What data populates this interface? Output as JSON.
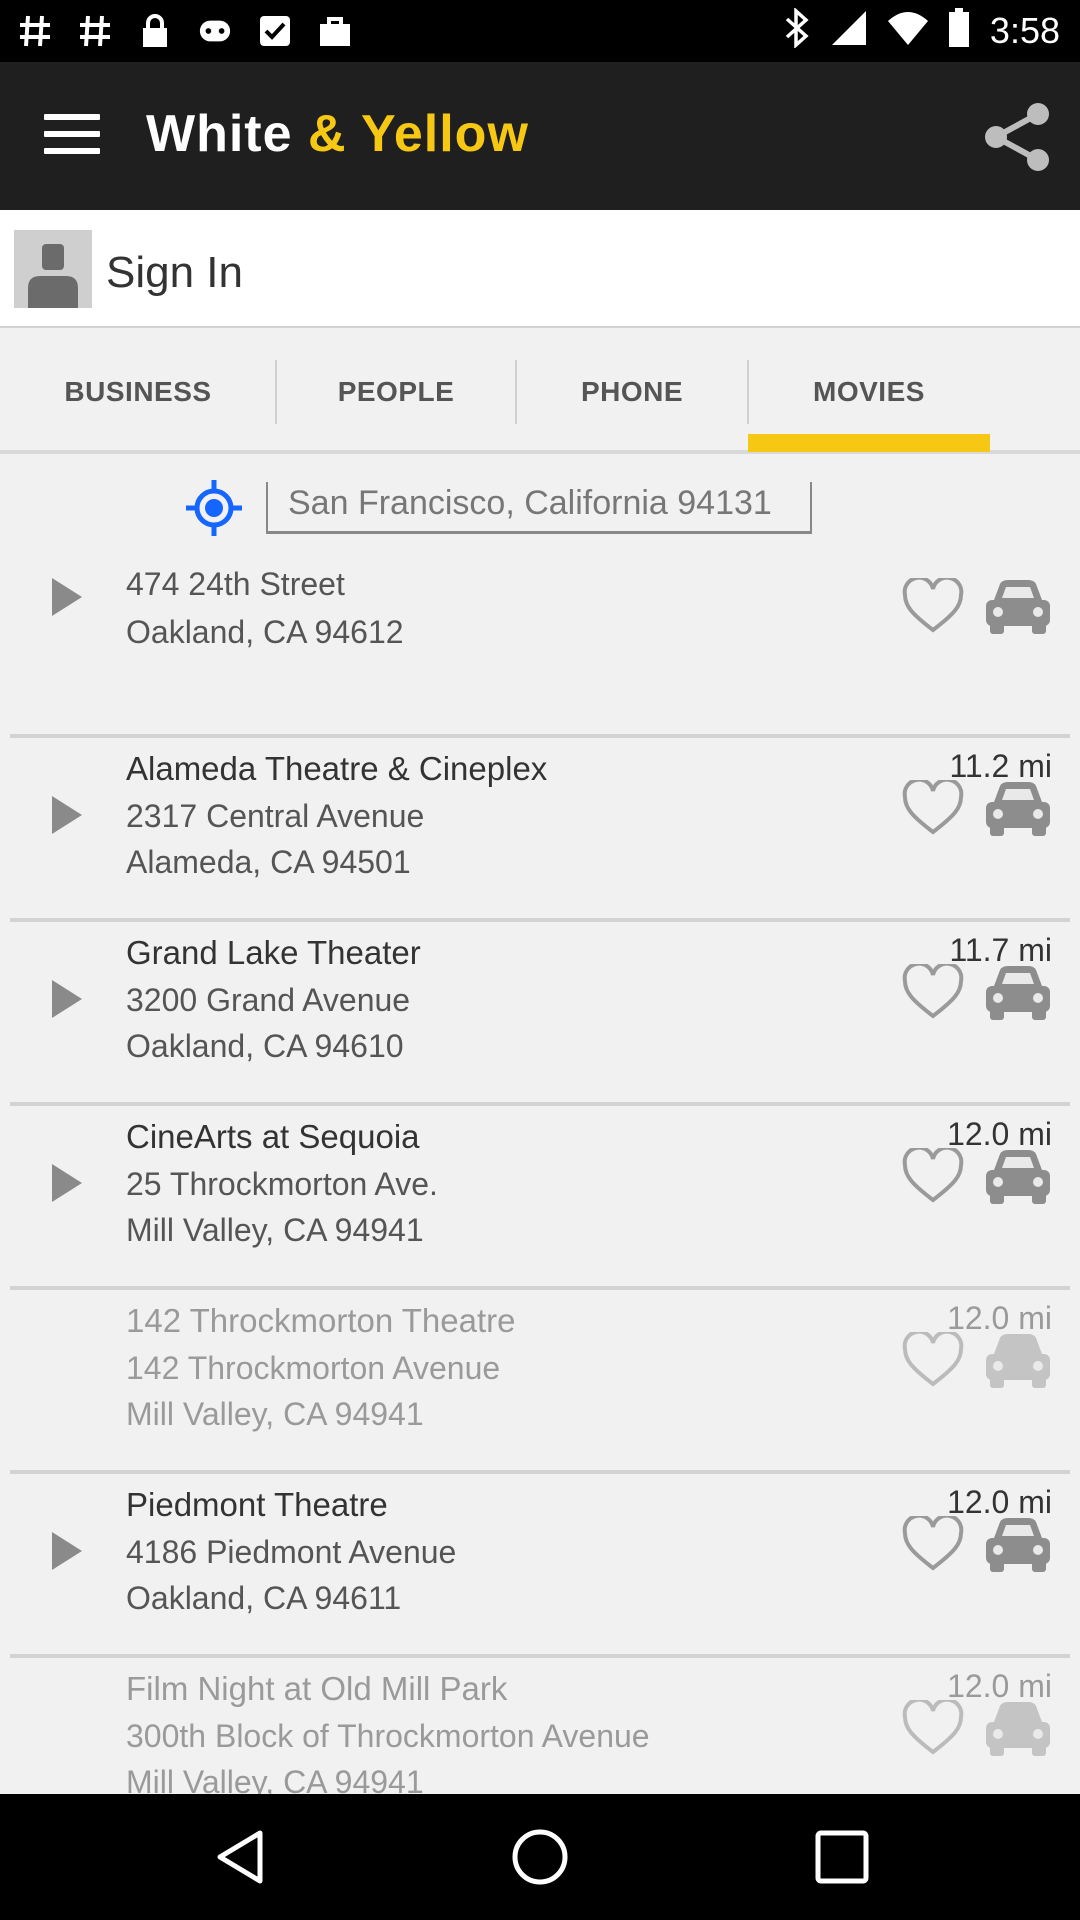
{
  "status_bar": {
    "time": "3:58",
    "left_icons": [
      "hash-icon",
      "hash-icon",
      "lock-icon",
      "game-controller-icon",
      "check-box-icon",
      "shopping-bag-icon"
    ],
    "right_icons": [
      "bluetooth-icon",
      "signal-icon",
      "wifi-icon",
      "battery-icon"
    ]
  },
  "app_bar": {
    "brand_white": "White",
    "brand_yellow": "& Yellow",
    "colors": {
      "bar": "#1f1f1f",
      "accent": "#f7c813"
    }
  },
  "signin": {
    "label": "Sign In"
  },
  "tabs": [
    {
      "label": "BUSINESS",
      "active": false
    },
    {
      "label": "PEOPLE",
      "active": false
    },
    {
      "label": "PHONE",
      "active": false
    },
    {
      "label": "MOVIES",
      "active": true
    }
  ],
  "location": {
    "value": "San Francisco, California 94131",
    "icon": "location-target-icon",
    "icon_color": "#1565ff"
  },
  "results": [
    {
      "name": "",
      "line1": "474 24th Street",
      "line2": "Oakland, CA 94612",
      "distance": "",
      "playable": true,
      "dimmed": false
    },
    {
      "name": "Alameda Theatre & Cineplex",
      "line1": "2317 Central Avenue",
      "line2": "Alameda, CA 94501",
      "distance": "11.2 mi",
      "playable": true,
      "dimmed": false
    },
    {
      "name": "Grand Lake Theater",
      "line1": "3200 Grand Avenue",
      "line2": "Oakland, CA 94610",
      "distance": "11.7 mi",
      "playable": true,
      "dimmed": false
    },
    {
      "name": "CineArts at Sequoia",
      "line1": "25 Throckmorton Ave.",
      "line2": "Mill Valley, CA 94941",
      "distance": "12.0 mi",
      "playable": true,
      "dimmed": false
    },
    {
      "name": "142 Throckmorton Theatre",
      "line1": "142 Throckmorton Avenue",
      "line2": "Mill Valley, CA 94941",
      "distance": "12.0 mi",
      "playable": false,
      "dimmed": true
    },
    {
      "name": "Piedmont Theatre",
      "line1": "4186 Piedmont Avenue",
      "line2": "Oakland, CA 94611",
      "distance": "12.0 mi",
      "playable": true,
      "dimmed": false
    },
    {
      "name": "Film Night at Old Mill Park",
      "line1": "300th Block of Throckmorton Avenue",
      "line2": "Mill Valley, CA 94941",
      "distance": "12.0 mi",
      "playable": false,
      "dimmed": true
    }
  ],
  "nav_bar": {
    "icons": [
      "back-icon",
      "home-icon",
      "recents-icon"
    ]
  }
}
